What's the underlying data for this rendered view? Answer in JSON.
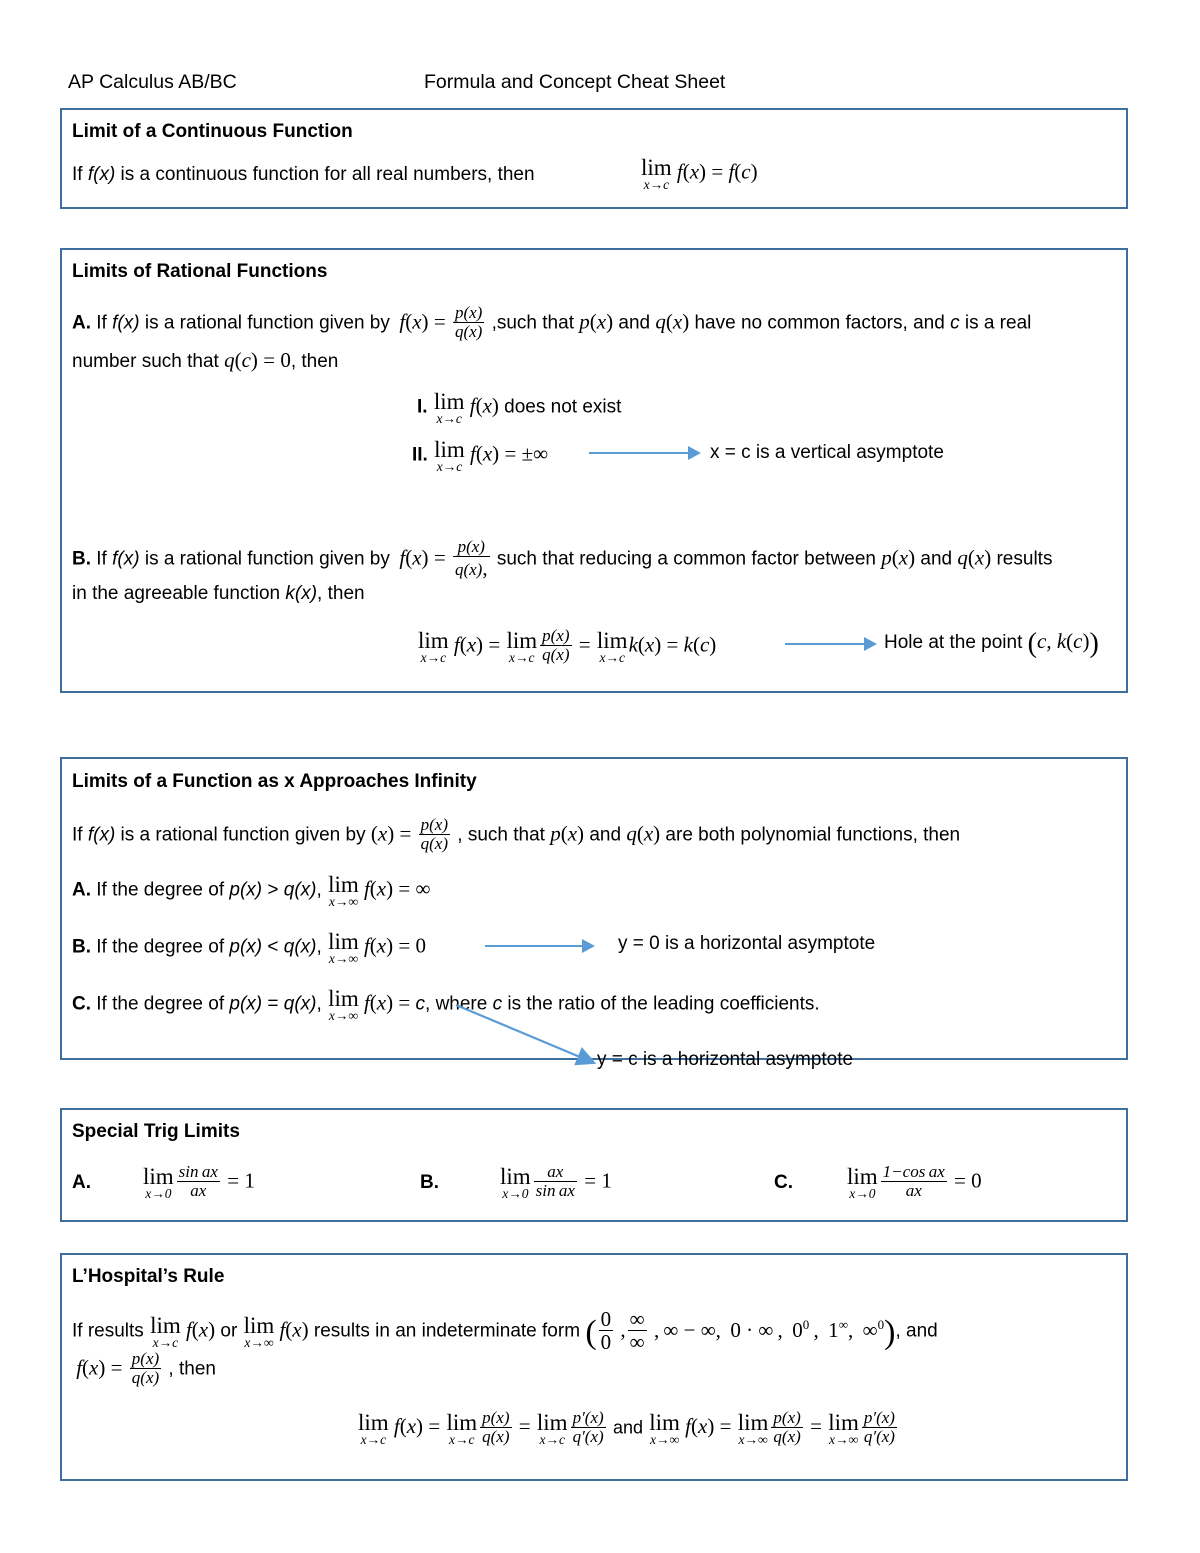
{
  "header": {
    "left": "AP Calculus AB/BC",
    "right": "Formula and Concept Cheat Sheet"
  },
  "sections": [
    {
      "id": "limit-continuous-function",
      "title": "Limit of a Continuous Function",
      "body_text": "If f(x) is a continuous function for all real numbers, then",
      "formula": "lim x→c f(x) = f(c)"
    },
    {
      "id": "limits-rational-functions",
      "title": "Limits of Rational Functions",
      "part_a_label": "A.",
      "part_a_line1": "If f(x) is a rational function given by f(x) = p(x)/q(x) ,such that p(x) and q(x) have no common factors, and c is a real",
      "part_a_line2": "number such that q(c) = 0, then",
      "item_i_label": "I.",
      "item_i_text": "lim x→c f(x) does not exist",
      "item_ii_label": "II.",
      "item_ii_text": "lim x→c f(x) = ±∞",
      "item_ii_result": "x = c is a vertical asymptote",
      "part_b_label": "B.",
      "part_b_line1": "If f(x) is a rational function given by f(x) = p(x)/q(x), such that reducing a common factor between p(x) and q(x) results",
      "part_b_line2": "in the agreeable function k(x), then",
      "part_b_formula": "lim x→c f(x) = lim x→c p(x)/q(x) = lim x→c k(x) = k(c)",
      "part_b_result": "Hole at the point (c, k(c))"
    },
    {
      "id": "limits-as-x-approaches-infinity",
      "title": "Limits of a Function as x Approaches Infinity",
      "intro": "If f(x) is a rational function given by (x) = p(x)/q(x) , such that p(x) and q(x) are both polynomial functions, then",
      "part_a_label": "A.",
      "part_a_text": "If the degree of p(x) > q(x), lim x→∞ f(x) = ∞",
      "part_b_label": "B.",
      "part_b_text": "If the degree of p(x) < q(x), lim x→∞ f(x) = 0",
      "part_b_result": "y = 0 is a horizontal asymptote",
      "part_c_label": "C.",
      "part_c_text": "If the degree of p(x) = q(x), lim x→∞ f(x) = c, where c is the ratio of the leading coefficients.",
      "part_c_result": "y = c is a horizontal asymptote"
    },
    {
      "id": "special-trig-limits",
      "title": "Special Trig Limits",
      "items": [
        {
          "label": "A.",
          "formula": "lim x→0  sin ax / ax = 1"
        },
        {
          "label": "B.",
          "formula": "lim x→0  ax / sin ax = 1"
        },
        {
          "label": "C.",
          "formula": "lim x→0  1−cos ax / ax = 0"
        }
      ]
    },
    {
      "id": "lhospitals-rule",
      "title": "L’Hospital’s Rule",
      "line1_a": "If results",
      "line1_b": "lim x→c f(x)",
      "line1_c": "or",
      "line1_d": "lim x→∞ f(x)",
      "line1_e": "results in an indeterminate form",
      "indeterminate_forms": [
        "0/0",
        "∞/∞",
        "∞ − ∞",
        "0 · ∞",
        "0⁰",
        "1∞",
        "∞⁰"
      ],
      "line1_f": ", and",
      "line2": "f(x) = p(x)/q(x) , then",
      "formula_left": "lim x→c f(x) = lim x→c p(x)/q(x) = lim x→c p′(x)/q′(x)",
      "formula_conj": "and",
      "formula_right": "lim x→∞ f(x) = lim x→∞ p(x)/q(x) = lim x→∞ p′(x)/q′(x)"
    }
  ],
  "colors": {
    "box_border": "#3f6d9e",
    "arrow": "#5b9bd5",
    "text": "#000000"
  },
  "glyphs": {
    "limit_word": "lim",
    "to_c": "x→c",
    "to_zero": "x→0",
    "to_infinity": "x→∞",
    "infinity": "∞",
    "plus_minus": "±",
    "equals": "=",
    "prime": "′"
  }
}
